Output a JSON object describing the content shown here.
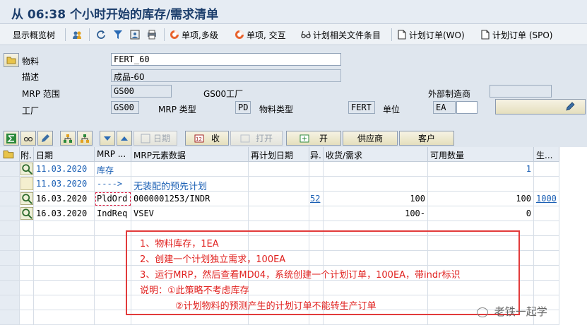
{
  "title": "从 06:38 个小时开始的库存/需求清单",
  "toolbar": {
    "items": [
      "显示概览树",
      "单项,多级",
      "单项, 交互",
      "计划相关文件条目",
      "计划订单(WO)",
      "计划订单 (SPO)"
    ]
  },
  "header": {
    "material_label": "物料",
    "material_value": "FERT_60",
    "description_label": "描述",
    "description_value": "成品-60",
    "mrp_area_label": "MRP 范围",
    "mrp_area_value": "GS00",
    "mrp_area_text": "GS00工厂",
    "external_label": "外部制造商",
    "plant_label": "工厂",
    "plant_value": "GS00",
    "mrp_type_label": "MRP 类型",
    "mrp_type_value": "PD",
    "material_type_label": "物料类型",
    "material_type_value": "FERT",
    "unit_label": "单位",
    "unit_value": "EA"
  },
  "grid_buttons": {
    "date": "日期",
    "receive": "收",
    "open": "打开",
    "open2": "开",
    "vendor": "供应商",
    "customer": "客户"
  },
  "columns": [
    "附.",
    "日期",
    "MRP ...",
    "MRP元素数据",
    "再计划日期",
    "异.",
    "收货/需求",
    "可用数量",
    "生..."
  ],
  "rows": [
    {
      "date": "11.03.2020",
      "mrp": "库存",
      "data": "",
      "resched": "",
      "exc": "",
      "recv": "",
      "avail": "1",
      "prod": ""
    },
    {
      "date": "11.03.2020",
      "mrp": "---->",
      "data": "无装配的预先计划",
      "resched": "",
      "exc": "",
      "recv": "",
      "avail": "",
      "prod": ""
    },
    {
      "date": "16.03.2020",
      "mrp": "PldOrd",
      "data": "0000001253/INDR",
      "resched": "",
      "exc": "52",
      "recv": "100",
      "avail": "100",
      "prod": "1000"
    },
    {
      "date": "16.03.2020",
      "mrp": "IndReq",
      "data": "VSEV",
      "resched": "",
      "exc": "",
      "recv": "100-",
      "avail": "0",
      "prod": ""
    }
  ],
  "annotation": [
    "1、物料库存，1EA",
    "2、创建一个计划独立需求，100EA",
    "3、运行MRP，然后查看MD04，系统创建一个计划订单，100EA，带indr标识",
    "说明：①此策略不考虑库存",
    "②计划物料的预测产生的计划订单不能转生产订单"
  ],
  "watermark": "老铁一起学"
}
